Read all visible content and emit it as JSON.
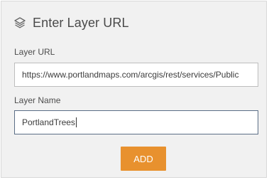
{
  "header": {
    "icon": "layers-icon",
    "title": "Enter Layer URL"
  },
  "form": {
    "url_label": "Layer URL",
    "url_value": "https://www.portlandmaps.com/arcgis/rest/services/Public",
    "name_label": "Layer Name",
    "name_value": "PortlandTrees"
  },
  "actions": {
    "add_label": "ADD"
  },
  "colors": {
    "accent": "#e8912e",
    "panel_bg": "#f1f1f1"
  }
}
